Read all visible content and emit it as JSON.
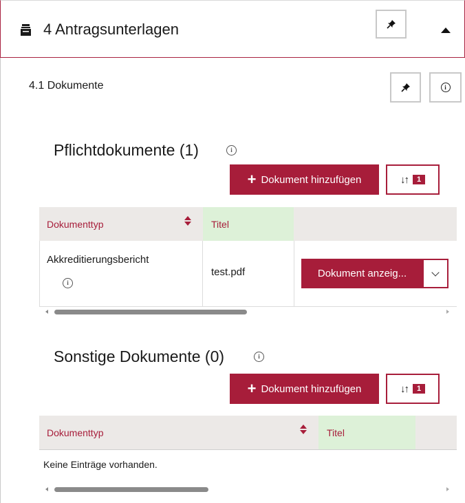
{
  "header": {
    "title": "4 Antragsunterlagen",
    "icon": "document-stack-icon",
    "pin_icon": "pin-icon",
    "collapse_icon": "caret-up-icon"
  },
  "subsection": {
    "title": "4.1 Dokumente",
    "info_glyph": "i"
  },
  "pflicht": {
    "title": "Pflichtdokumente (1)",
    "info_glyph": "i",
    "add_label": "Dokument hinzufügen",
    "sort_glyph": "↓↑",
    "sort_badge": "1",
    "columns": [
      "Dokumenttyp",
      "Titel"
    ],
    "rows": [
      {
        "dokumenttyp": "Akkreditierungsbericht",
        "info_glyph": "i",
        "titel": "test.pdf",
        "action": "Dokument anzeig..."
      }
    ],
    "scroll_fraction": 0.5
  },
  "sonstige": {
    "title": "Sonstige Dokumente (0)",
    "info_glyph": "i",
    "add_label": "Dokument hinzufügen",
    "sort_glyph": "↓↑",
    "sort_badge": "1",
    "columns": [
      "Dokumenttyp",
      "Titel"
    ],
    "empty_text": "Keine Einträge vorhanden.",
    "scroll_fraction": 0.4
  },
  "colors": {
    "accent": "#a71d3a",
    "header_bg": "#ece9e7",
    "titel_bg": "#ddf1d8"
  }
}
